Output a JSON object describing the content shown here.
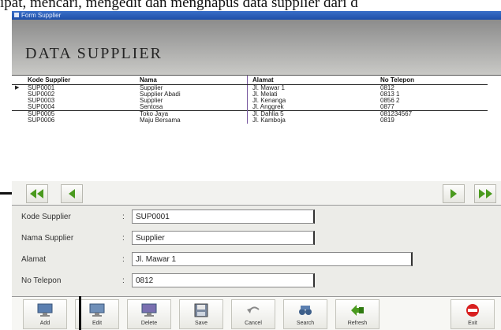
{
  "document_text": "ipat, mencari, mengedit dan menghapus data supplier dari d",
  "window": {
    "title": "Form Supplier"
  },
  "header": {
    "title": "DATA SUPPLIER"
  },
  "grid": {
    "columns": [
      "Kode Supplier",
      "Nama",
      "Alamat",
      "No Telepon"
    ],
    "rows": [
      {
        "marker": "▶",
        "cells": [
          "SUP0001",
          "Supplier",
          "Jl. Mawar 1",
          "0812"
        ]
      },
      {
        "marker": "",
        "cells": [
          "SUP0002",
          "Supplier Abadi",
          "Jl. Melati",
          "0813 1"
        ]
      },
      {
        "marker": "",
        "cells": [
          "SUP0003",
          "Supplier",
          "Jl. Kenanga",
          "0856 2"
        ]
      },
      {
        "marker": "",
        "cells": [
          "SUP0004",
          "Sentosa",
          "Jl. Anggrek",
          "0877"
        ]
      },
      {
        "marker": "",
        "cells": [
          "SUP0005",
          "Toko Jaya",
          "Jl. Dahlia 5",
          "081234567"
        ]
      },
      {
        "marker": "",
        "cells": [
          "SUP0006",
          "Maju Bersama",
          "Jl. Kamboja",
          "0819"
        ]
      }
    ]
  },
  "nav": {
    "first": "first-record",
    "prev": "previous-record",
    "next": "next-record",
    "last": "last-record"
  },
  "form": {
    "kode_label": "Kode Supplier",
    "kode_value": "SUP0001",
    "nama_label": "Nama Supplier",
    "nama_value": "Supplier",
    "alamat_label": "Alamat",
    "alamat_value": "Jl. Mawar 1",
    "telp_label": "No Telepon",
    "telp_value": "0812"
  },
  "toolbar": {
    "buttons": [
      "Add",
      "Edit",
      "Delete",
      "Save",
      "Cancel",
      "Search",
      "Refresh",
      "Exit"
    ]
  },
  "colors": {
    "titlebar": "#1e4ea8",
    "nav_arrow": "#4a9a1e",
    "exit_icon": "#d82020"
  }
}
